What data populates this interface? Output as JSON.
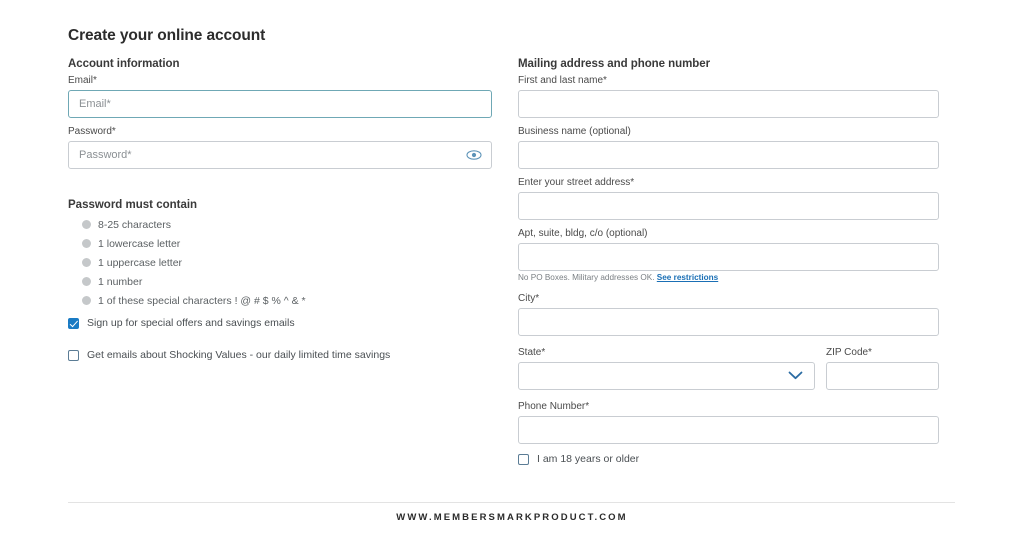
{
  "page": {
    "title": "Create your online account"
  },
  "account_section": {
    "heading": "Account information",
    "email": {
      "label": "Email*",
      "placeholder": "Email*",
      "value": ""
    },
    "password": {
      "label": "Password*",
      "placeholder": "Password*",
      "value": "",
      "toggle_icon": "eye-icon"
    }
  },
  "password_rules": {
    "heading": "Password must contain",
    "items": [
      {
        "text": "8-25 characters",
        "met": false
      },
      {
        "text": "1 lowercase letter",
        "met": false
      },
      {
        "text": "1 uppercase letter",
        "met": false
      },
      {
        "text": "1 number",
        "met": false
      },
      {
        "text": "1 of these special characters ! @ # $ % ^ & *",
        "met": false
      }
    ]
  },
  "opt_ins": [
    {
      "label": "Sign up for special offers and savings emails",
      "checked": true
    },
    {
      "label": "Get emails about Shocking Values - our daily limited time savings",
      "checked": false
    }
  ],
  "mailing_section": {
    "heading": "Mailing address and phone number",
    "full_name": {
      "label": "First and last name*",
      "value": "",
      "placeholder": ""
    },
    "business_name": {
      "label": "Business name (optional)",
      "value": "",
      "placeholder": ""
    },
    "street_address": {
      "label": "Enter your street address*",
      "value": "",
      "placeholder": ""
    },
    "apt": {
      "label": "Apt, suite, bldg, c/o (optional)",
      "value": "",
      "placeholder": ""
    },
    "po_note": {
      "text": "No PO Boxes. Military addresses OK.",
      "link_text": "See restrictions"
    },
    "city": {
      "label": "City*",
      "value": "",
      "placeholder": ""
    },
    "state": {
      "label": "State*",
      "value": "",
      "placeholder": "",
      "chevron_icon": "chevron-down-icon"
    },
    "zip": {
      "label": "ZIP Code*",
      "value": "",
      "placeholder": ""
    },
    "phone": {
      "label": "Phone Number*",
      "value": "",
      "placeholder": ""
    },
    "age_confirm": {
      "label": "I am 18 years or older",
      "checked": false
    }
  },
  "footer": {
    "url": "WWW.MEMBERSMARKPRODUCT.COM"
  },
  "colors": {
    "accent_blue": "#1a7bc4",
    "link_blue": "#1a6fb5",
    "active_border": "#6fa8b5",
    "border_gray": "#c9cdd2",
    "dot_gray": "#c5c8ca"
  }
}
